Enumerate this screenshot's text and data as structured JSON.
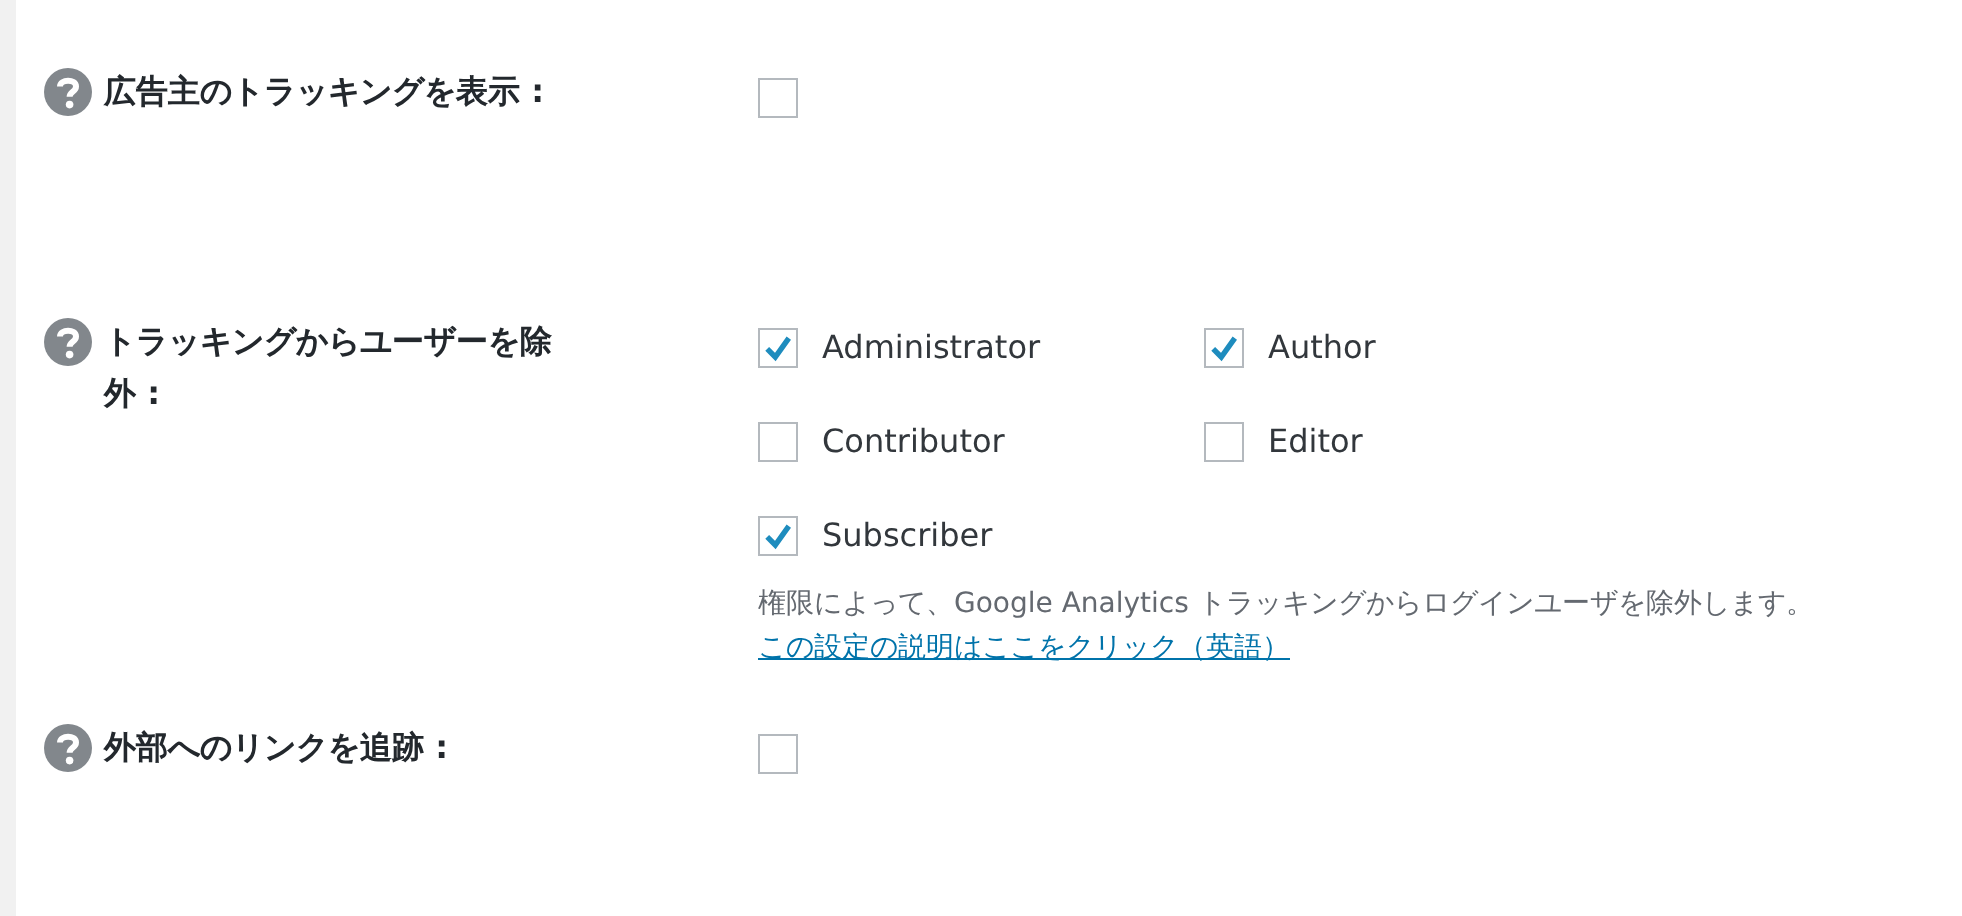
{
  "settings": [
    {
      "kind": "single",
      "label": "広告主のトラッキングを表示 :",
      "checked": false
    },
    {
      "kind": "roles",
      "label": "トラッキングからユーザーを除外 :",
      "options": [
        {
          "label": "Administrator",
          "checked": true
        },
        {
          "label": "Author",
          "checked": true
        },
        {
          "label": "Contributor",
          "checked": false
        },
        {
          "label": "Editor",
          "checked": false
        },
        {
          "label": "Subscriber",
          "checked": true
        }
      ],
      "description": "権限によって、Google Analytics トラッキングからログインユーザを除外します。",
      "link": "この設定の説明はここをクリック（英語）"
    },
    {
      "kind": "single",
      "label": "外部へのリンクを追跡 :",
      "checked": false
    }
  ]
}
